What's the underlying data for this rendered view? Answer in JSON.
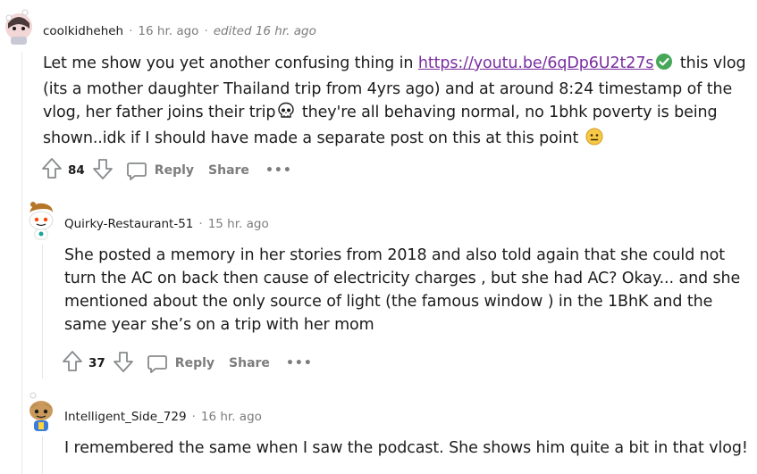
{
  "comments": [
    {
      "username": "coolkidheheh",
      "time": "16 hr. ago",
      "edited": "edited 16 hr. ago",
      "text_before_link": "Let me show you yet another confusing thing in ",
      "link": "https://youtu.be/6qDp6U2t27s",
      "text_after_link": " this vlog (its a mother daughter Thailand trip from 4yrs ago) and at around 8:24 timestamp of the vlog, her father joins their trip",
      "text_after_skull": " they're all behaving normal, no 1bhk poverty is being shown..idk if I should have made a separate post on this at this point ",
      "upvotes": "84",
      "reply_label": "Reply",
      "share_label": "Share",
      "more_label": "•••"
    },
    {
      "username": "Quirky-Restaurant-51",
      "time": "15 hr. ago",
      "text": "She posted a memory in her stories from 2018 and also told again that she could not turn the AC on back then cause of electricity charges , but she had AC? Okay... and she mentioned about the only source of light (the famous window ) in the 1BhK and the same year she’s on a trip with her mom",
      "upvotes": "37",
      "reply_label": "Reply",
      "share_label": "Share",
      "more_label": "•••"
    },
    {
      "username": "Intelligent_Side_729",
      "time": "16 hr. ago",
      "text": "I remembered the same when I saw the podcast. She shows him quite a bit in that vlog!"
    }
  ],
  "colors": {
    "link": "#7a2ea0",
    "verified": "#46a758",
    "muted": "#7c7c7c"
  }
}
